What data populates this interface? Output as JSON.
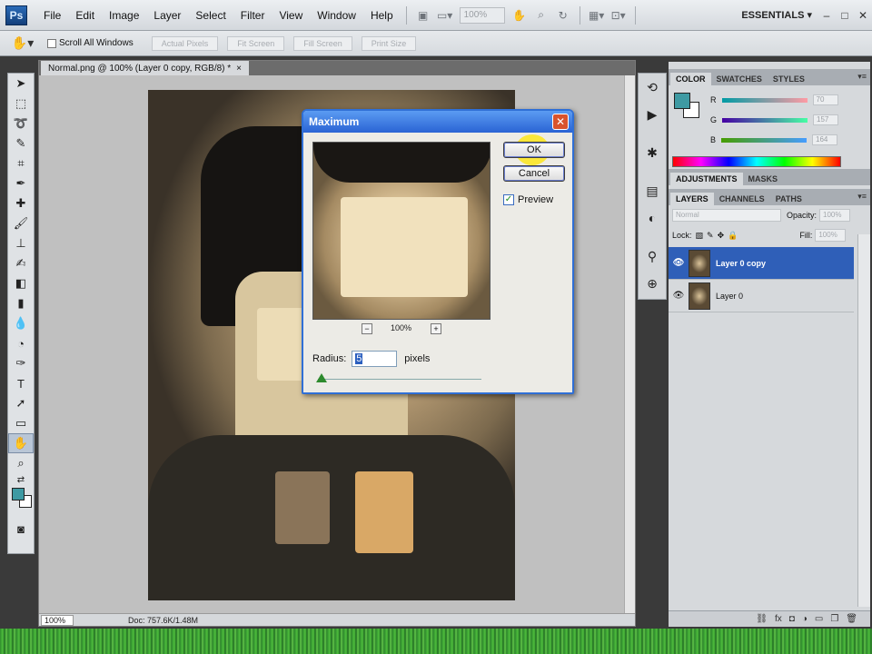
{
  "app": {
    "logo": "Ps",
    "menu": [
      "File",
      "Edit",
      "Image",
      "Layer",
      "Select",
      "Filter",
      "View",
      "Window",
      "Help"
    ],
    "zoom": "100%",
    "workspace": "ESSENTIALS ▾",
    "window_controls": [
      "–",
      "□",
      "✕"
    ]
  },
  "options_bar": {
    "scroll_all_windows": "Scroll All Windows",
    "buttons": [
      "Actual Pixels",
      "Fit Screen",
      "Fill Screen",
      "Print Size"
    ]
  },
  "document": {
    "tab_title": "Normal.png @ 100% (Layer 0 copy, RGB/8) *",
    "tab_close": "×",
    "status_zoom": "100%",
    "status_info": "Doc: 757.6K/1.48M"
  },
  "dialog": {
    "title": "Maximum",
    "close": "✕",
    "ok": "OK",
    "cancel": "Cancel",
    "preview_label": "Preview",
    "preview_checked": true,
    "preview_zoom": "100%",
    "zoom_out": "−",
    "zoom_in": "+",
    "radius_label": "Radius:",
    "radius_value": "5",
    "radius_unit": "pixels"
  },
  "panels": {
    "color_tabs": [
      "COLOR",
      "SWATCHES",
      "STYLES"
    ],
    "rgb": [
      {
        "label": "R",
        "value": "70"
      },
      {
        "label": "G",
        "value": "157"
      },
      {
        "label": "B",
        "value": "164"
      }
    ],
    "adjustment_tabs": [
      "ADJUSTMENTS",
      "MASKS"
    ],
    "layer_tabs": [
      "LAYERS",
      "CHANNELS",
      "PATHS"
    ],
    "blend_mode": "Normal",
    "opacity_label": "Opacity:",
    "opacity_value": "100%",
    "lock_label": "Lock:",
    "fill_label": "Fill:",
    "fill_value": "100%",
    "layers": [
      {
        "name": "Layer 0 copy",
        "selected": true
      },
      {
        "name": "Layer 0",
        "selected": false
      }
    ]
  },
  "colors": {
    "foreground": "#3e9aa3",
    "background": "#ffffff",
    "dialog_title": "#2a63d4",
    "layer_selected": "#2f5fb8"
  }
}
